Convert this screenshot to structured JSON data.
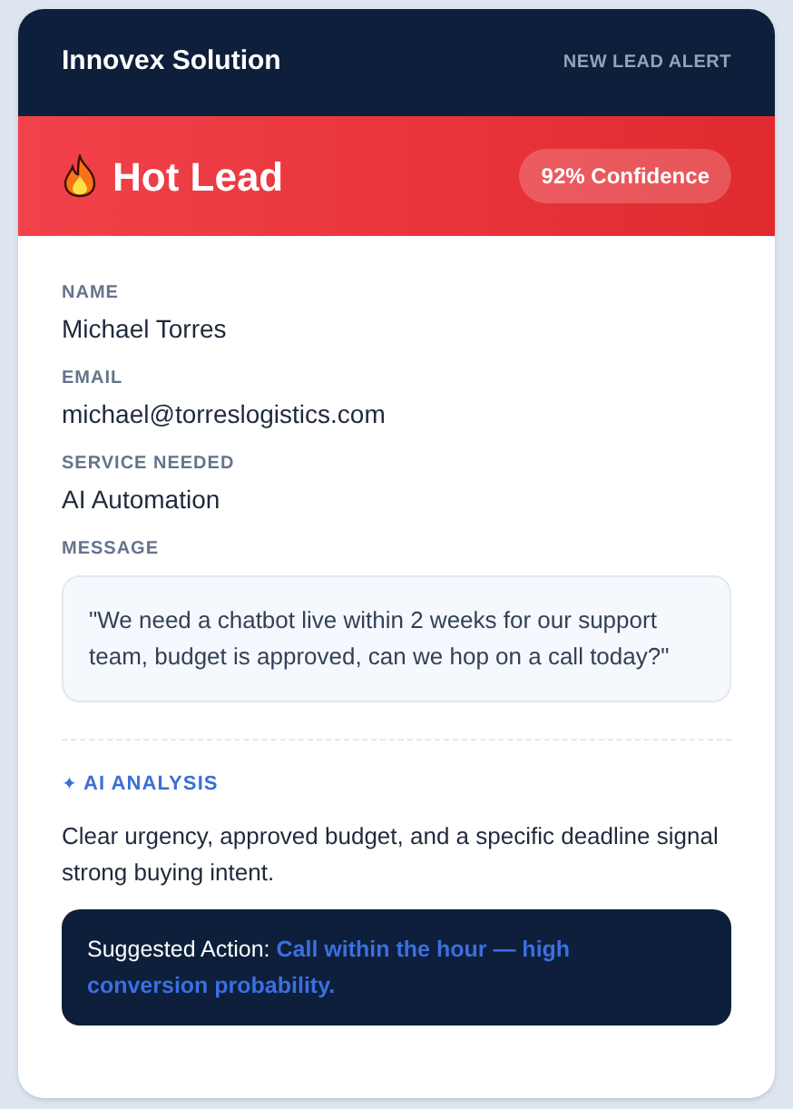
{
  "header": {
    "brand": "Innovex Solution",
    "tag": "NEW LEAD ALERT"
  },
  "banner": {
    "title": "Hot Lead",
    "confidence": "92% Confidence"
  },
  "fields": [
    {
      "label": "NAME",
      "value": "Michael Torres"
    },
    {
      "label": "EMAIL",
      "value": "michael@torreslogistics.com"
    },
    {
      "label": "SERVICE NEEDED",
      "value": "AI Automation"
    }
  ],
  "message": {
    "label": "MESSAGE",
    "text": "\"We need a chatbot live within 2 weeks for our support team, budget is approved, can we hop on a call today?\""
  },
  "analysis": {
    "icon": "✦",
    "label": "AI ANALYSIS",
    "text": "Clear urgency, approved budget, and a specific deadline signal strong buying intent.",
    "action_label": "Suggested Action:",
    "action_text": "Call within the hour — high conversion probability."
  }
}
